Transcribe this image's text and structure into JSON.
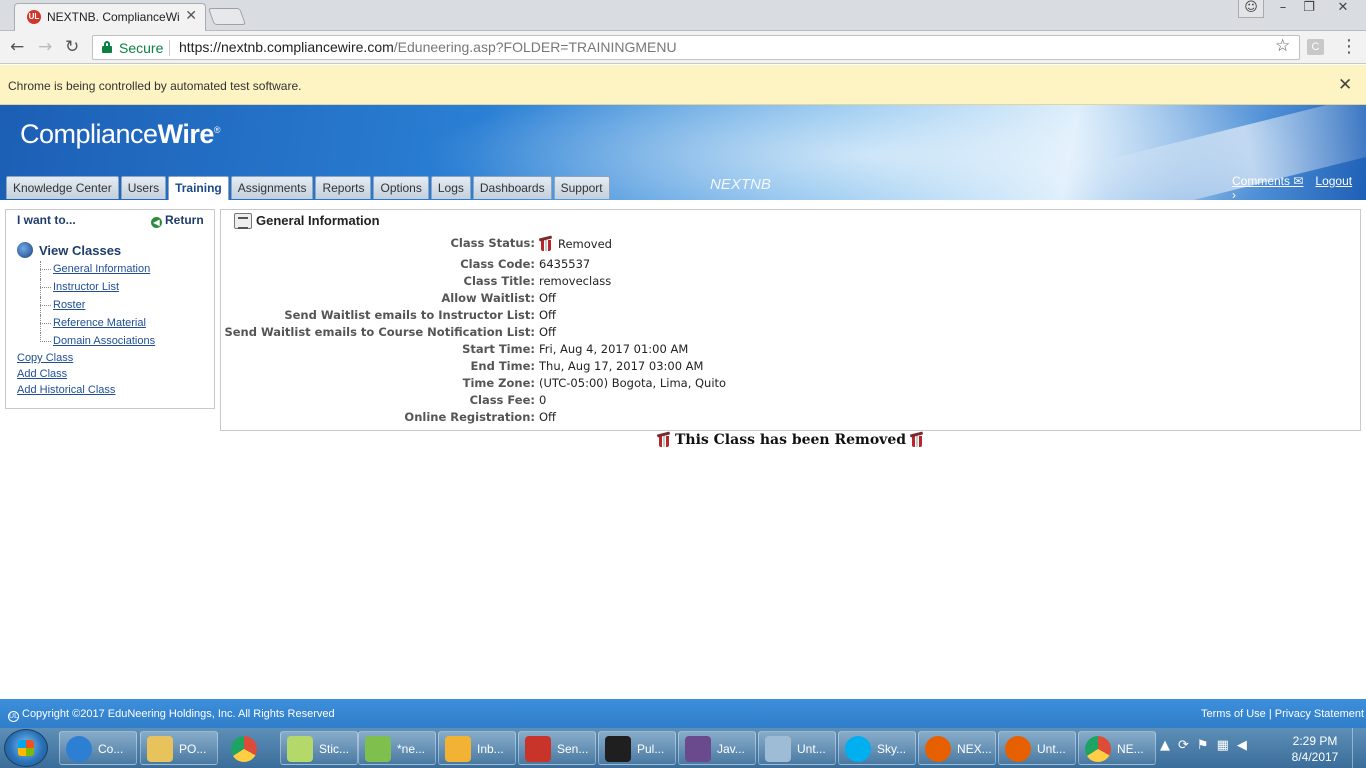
{
  "browser": {
    "tab_title": "NEXTNB. ComplianceWir",
    "tab_favicon_text": "UL",
    "secure_label": "Secure",
    "url_host": "https://nextnb.compliancewire.com",
    "url_path": "/Eduneering.asp?FOLDER=TRAININGMENU",
    "extension_letter": "C",
    "infobar_text": "Chrome is being controlled by automated test software."
  },
  "header": {
    "logo_regular": "Compliance",
    "logo_bold": "Wire",
    "logo_mark": "®",
    "company": "NEXTNB",
    "comments_link": "Comments ✉",
    "logout_link": "Logout ›",
    "nav_tabs": [
      "Knowledge Center",
      "Users",
      "Training",
      "Assignments",
      "Reports",
      "Options",
      "Logs",
      "Dashboards",
      "Support"
    ],
    "active_tab": "Training"
  },
  "sidebar": {
    "title": "I want to...",
    "return_label": "Return",
    "section_label": "View Classes",
    "tree_items": [
      "General Information",
      "Instructor List",
      "Roster",
      "Reference Material",
      "Domain Associations"
    ],
    "links": [
      "Copy Class",
      "Add Class",
      "Add Historical Class"
    ]
  },
  "main": {
    "panel_title": "General Information",
    "fields": [
      {
        "label": "Class Status:",
        "value": "Removed"
      },
      {
        "label": "Class Code:",
        "value": "6435537"
      },
      {
        "label": "Class Title:",
        "value": "removeclass"
      },
      {
        "label": "Allow Waitlist:",
        "value": "Off"
      },
      {
        "label": "Send Waitlist emails to Instructor List:",
        "value": "Off"
      },
      {
        "label": "Send Waitlist emails to Course Notification List:",
        "value": "Off"
      },
      {
        "label": "Start Time:",
        "value": "Fri, Aug 4, 2017 01:00 AM"
      },
      {
        "label": "End Time:",
        "value": "Thu, Aug 17, 2017 03:00 AM"
      },
      {
        "label": "Time Zone:",
        "value": "(UTC-05:00) Bogota, Lima, Quito"
      },
      {
        "label": "Class Fee:",
        "value": "0"
      },
      {
        "label": "Online Registration:",
        "value": "Off"
      }
    ],
    "removed_message": "This Class has been Removed"
  },
  "footer": {
    "copyright": "Copyright ©2017 EduNeering Holdings, Inc. All Rights Reserved",
    "copyright_mark": "UL",
    "terms": "Terms of Use",
    "separator": "|",
    "privacy": "Privacy Statement"
  },
  "taskbar": {
    "items": [
      {
        "label": "Co...",
        "icon": "internet-explorer-icon",
        "color": "#2d7fd3"
      },
      {
        "label": "PO...",
        "icon": "folder-icon",
        "color": "#e8c25a"
      },
      {
        "label": "",
        "icon": "chrome-icon",
        "color": "#dd4b39"
      },
      {
        "label": "Stic...",
        "icon": "sticky-notes-icon",
        "color": "#b5d86b"
      },
      {
        "label": "*ne...",
        "icon": "notepad-plus-icon",
        "color": "#7fbf4d"
      },
      {
        "label": "Inb...",
        "icon": "outlook-icon",
        "color": "#f2b233"
      },
      {
        "label": "Sen...",
        "icon": "selenium-icon",
        "color": "#c8342a"
      },
      {
        "label": "Pul...",
        "icon": "pulse-icon",
        "color": "#1f1f1f"
      },
      {
        "label": "Jav...",
        "icon": "java-ee-ide-icon",
        "color": "#6a4a8c"
      },
      {
        "label": "Unt...",
        "icon": "document-icon",
        "color": "#9fbcd6"
      },
      {
        "label": "Sky...",
        "icon": "skype-icon",
        "color": "#00aff0"
      },
      {
        "label": "NEX...",
        "icon": "firefox-icon",
        "color": "#e66000"
      },
      {
        "label": "Unt...",
        "icon": "firefox-icon",
        "color": "#e66000"
      },
      {
        "label": "NE...",
        "icon": "chrome-icon",
        "color": "#dd4b39"
      }
    ],
    "time": "2:29 PM",
    "date": "8/4/2017"
  }
}
